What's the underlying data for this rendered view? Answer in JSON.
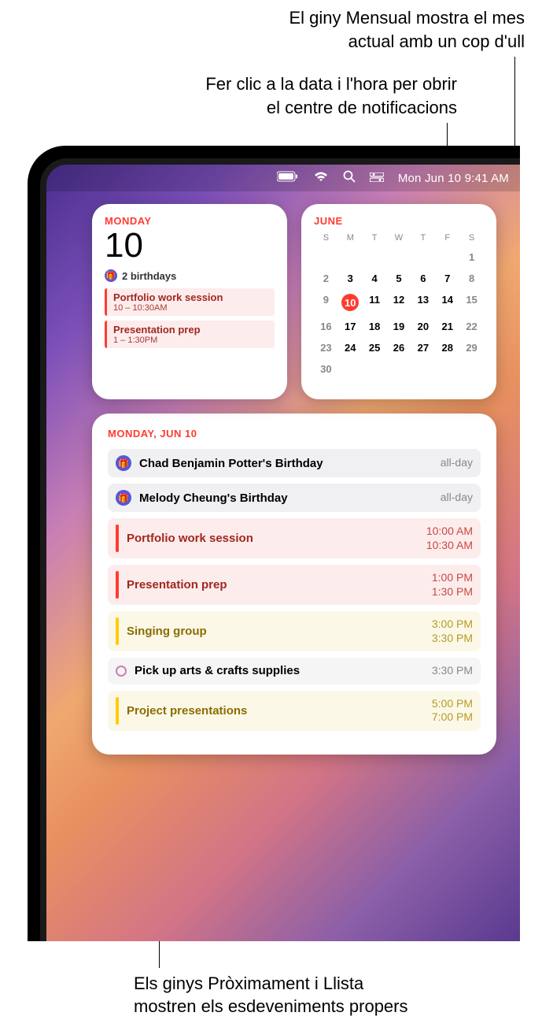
{
  "callouts": {
    "monthly": "El giny Mensual mostra el mes\nactual amb un cop d'ull",
    "clock": "Fer clic a la data i l'hora per obrir\nel centre de notificacions",
    "list": "Els ginys Pròximament i Llista\nmostren els esdeveniments propers"
  },
  "menubar": {
    "clock": "Mon Jun 10  9:41 AM"
  },
  "today_widget": {
    "day": "MONDAY",
    "num": "10",
    "birthdays": "2 birthdays",
    "events": [
      {
        "title": "Portfolio work session",
        "time": "10 – 10:30AM"
      },
      {
        "title": "Presentation prep",
        "time": "1 – 1:30PM"
      }
    ]
  },
  "month_widget": {
    "title": "JUNE",
    "dow": [
      "S",
      "M",
      "T",
      "W",
      "T",
      "F",
      "S"
    ],
    "weeks": [
      [
        null,
        null,
        null,
        null,
        null,
        null,
        1
      ],
      [
        2,
        3,
        4,
        5,
        6,
        7,
        8
      ],
      [
        9,
        10,
        11,
        12,
        13,
        14,
        15
      ],
      [
        16,
        17,
        18,
        19,
        20,
        21,
        22
      ],
      [
        23,
        24,
        25,
        26,
        27,
        28,
        29
      ],
      [
        30,
        null,
        null,
        null,
        null,
        null,
        null
      ]
    ],
    "today": 10
  },
  "list_widget": {
    "header": "MONDAY, JUN 10",
    "events": [
      {
        "type": "bday",
        "title": "Chad Benjamin Potter's Birthday",
        "time": "all-day"
      },
      {
        "type": "bday",
        "title": "Melody Cheung's Birthday",
        "time": "all-day"
      },
      {
        "type": "red",
        "title": "Portfolio work session",
        "start": "10:00 AM",
        "end": "10:30 AM"
      },
      {
        "type": "red",
        "title": "Presentation prep",
        "start": "1:00 PM",
        "end": "1:30 PM"
      },
      {
        "type": "yellow",
        "title": "Singing group",
        "start": "3:00 PM",
        "end": "3:30 PM"
      },
      {
        "type": "outline",
        "title": "Pick up arts & crafts supplies",
        "time": "3:30 PM"
      },
      {
        "type": "yellow",
        "title": "Project presentations",
        "start": "5:00 PM",
        "end": "7:00 PM"
      }
    ]
  }
}
